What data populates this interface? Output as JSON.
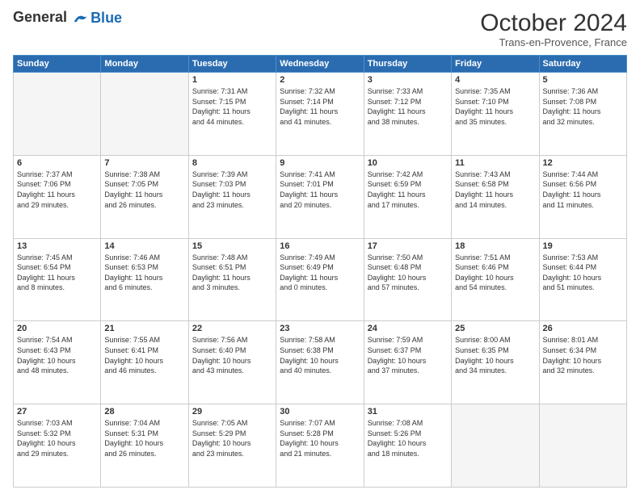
{
  "header": {
    "logo_line1": "General",
    "logo_line2": "Blue",
    "title": "October 2024",
    "location": "Trans-en-Provence, France"
  },
  "days_of_week": [
    "Sunday",
    "Monday",
    "Tuesday",
    "Wednesday",
    "Thursday",
    "Friday",
    "Saturday"
  ],
  "weeks": [
    [
      {
        "num": "",
        "info": ""
      },
      {
        "num": "",
        "info": ""
      },
      {
        "num": "1",
        "info": "Sunrise: 7:31 AM\nSunset: 7:15 PM\nDaylight: 11 hours\nand 44 minutes."
      },
      {
        "num": "2",
        "info": "Sunrise: 7:32 AM\nSunset: 7:14 PM\nDaylight: 11 hours\nand 41 minutes."
      },
      {
        "num": "3",
        "info": "Sunrise: 7:33 AM\nSunset: 7:12 PM\nDaylight: 11 hours\nand 38 minutes."
      },
      {
        "num": "4",
        "info": "Sunrise: 7:35 AM\nSunset: 7:10 PM\nDaylight: 11 hours\nand 35 minutes."
      },
      {
        "num": "5",
        "info": "Sunrise: 7:36 AM\nSunset: 7:08 PM\nDaylight: 11 hours\nand 32 minutes."
      }
    ],
    [
      {
        "num": "6",
        "info": "Sunrise: 7:37 AM\nSunset: 7:06 PM\nDaylight: 11 hours\nand 29 minutes."
      },
      {
        "num": "7",
        "info": "Sunrise: 7:38 AM\nSunset: 7:05 PM\nDaylight: 11 hours\nand 26 minutes."
      },
      {
        "num": "8",
        "info": "Sunrise: 7:39 AM\nSunset: 7:03 PM\nDaylight: 11 hours\nand 23 minutes."
      },
      {
        "num": "9",
        "info": "Sunrise: 7:41 AM\nSunset: 7:01 PM\nDaylight: 11 hours\nand 20 minutes."
      },
      {
        "num": "10",
        "info": "Sunrise: 7:42 AM\nSunset: 6:59 PM\nDaylight: 11 hours\nand 17 minutes."
      },
      {
        "num": "11",
        "info": "Sunrise: 7:43 AM\nSunset: 6:58 PM\nDaylight: 11 hours\nand 14 minutes."
      },
      {
        "num": "12",
        "info": "Sunrise: 7:44 AM\nSunset: 6:56 PM\nDaylight: 11 hours\nand 11 minutes."
      }
    ],
    [
      {
        "num": "13",
        "info": "Sunrise: 7:45 AM\nSunset: 6:54 PM\nDaylight: 11 hours\nand 8 minutes."
      },
      {
        "num": "14",
        "info": "Sunrise: 7:46 AM\nSunset: 6:53 PM\nDaylight: 11 hours\nand 6 minutes."
      },
      {
        "num": "15",
        "info": "Sunrise: 7:48 AM\nSunset: 6:51 PM\nDaylight: 11 hours\nand 3 minutes."
      },
      {
        "num": "16",
        "info": "Sunrise: 7:49 AM\nSunset: 6:49 PM\nDaylight: 11 hours\nand 0 minutes."
      },
      {
        "num": "17",
        "info": "Sunrise: 7:50 AM\nSunset: 6:48 PM\nDaylight: 10 hours\nand 57 minutes."
      },
      {
        "num": "18",
        "info": "Sunrise: 7:51 AM\nSunset: 6:46 PM\nDaylight: 10 hours\nand 54 minutes."
      },
      {
        "num": "19",
        "info": "Sunrise: 7:53 AM\nSunset: 6:44 PM\nDaylight: 10 hours\nand 51 minutes."
      }
    ],
    [
      {
        "num": "20",
        "info": "Sunrise: 7:54 AM\nSunset: 6:43 PM\nDaylight: 10 hours\nand 48 minutes."
      },
      {
        "num": "21",
        "info": "Sunrise: 7:55 AM\nSunset: 6:41 PM\nDaylight: 10 hours\nand 46 minutes."
      },
      {
        "num": "22",
        "info": "Sunrise: 7:56 AM\nSunset: 6:40 PM\nDaylight: 10 hours\nand 43 minutes."
      },
      {
        "num": "23",
        "info": "Sunrise: 7:58 AM\nSunset: 6:38 PM\nDaylight: 10 hours\nand 40 minutes."
      },
      {
        "num": "24",
        "info": "Sunrise: 7:59 AM\nSunset: 6:37 PM\nDaylight: 10 hours\nand 37 minutes."
      },
      {
        "num": "25",
        "info": "Sunrise: 8:00 AM\nSunset: 6:35 PM\nDaylight: 10 hours\nand 34 minutes."
      },
      {
        "num": "26",
        "info": "Sunrise: 8:01 AM\nSunset: 6:34 PM\nDaylight: 10 hours\nand 32 minutes."
      }
    ],
    [
      {
        "num": "27",
        "info": "Sunrise: 7:03 AM\nSunset: 5:32 PM\nDaylight: 10 hours\nand 29 minutes."
      },
      {
        "num": "28",
        "info": "Sunrise: 7:04 AM\nSunset: 5:31 PM\nDaylight: 10 hours\nand 26 minutes."
      },
      {
        "num": "29",
        "info": "Sunrise: 7:05 AM\nSunset: 5:29 PM\nDaylight: 10 hours\nand 23 minutes."
      },
      {
        "num": "30",
        "info": "Sunrise: 7:07 AM\nSunset: 5:28 PM\nDaylight: 10 hours\nand 21 minutes."
      },
      {
        "num": "31",
        "info": "Sunrise: 7:08 AM\nSunset: 5:26 PM\nDaylight: 10 hours\nand 18 minutes."
      },
      {
        "num": "",
        "info": ""
      },
      {
        "num": "",
        "info": ""
      }
    ]
  ]
}
